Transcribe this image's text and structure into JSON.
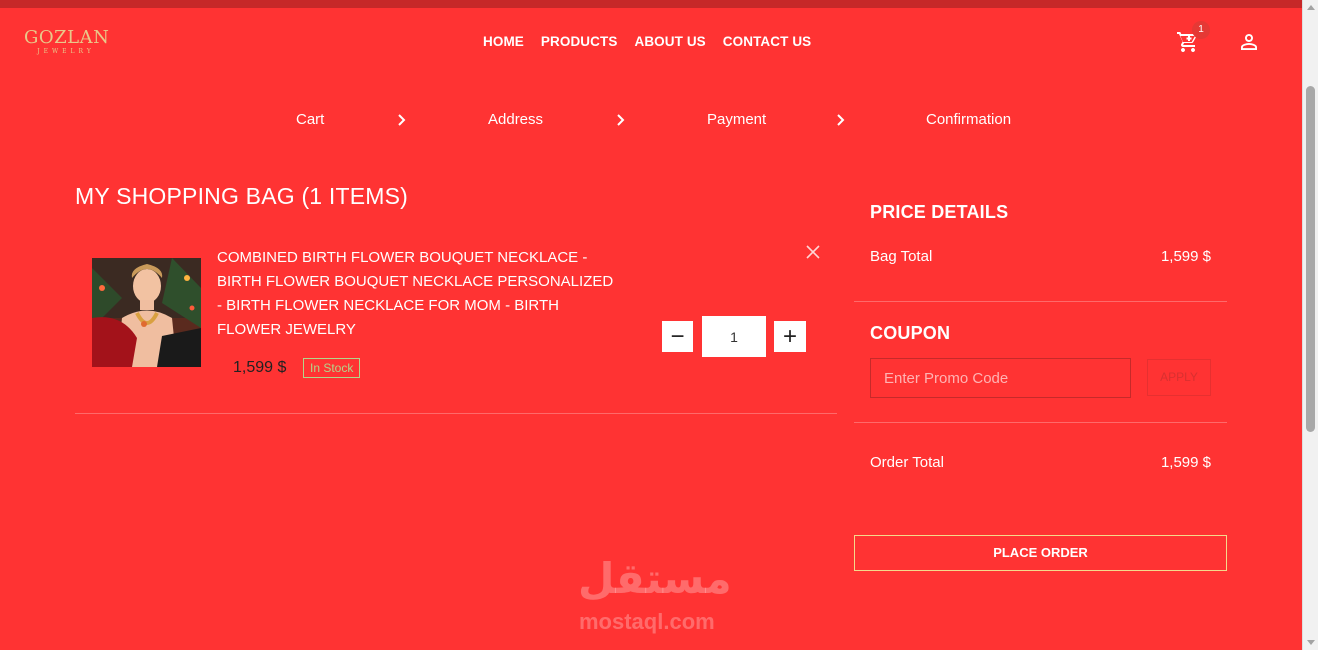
{
  "header": {
    "logo_main": "GOZLAN",
    "logo_sub": "JEWELRY",
    "nav": [
      "HOME",
      "PRODUCTS",
      "ABOUT US",
      "CONTACT US"
    ],
    "cart_count": "1",
    "cart_icon": "shopping-cart-icon",
    "user_icon": "user-icon"
  },
  "steps": [
    "Cart",
    "Address",
    "Payment",
    "Confirmation"
  ],
  "bag": {
    "title": "MY SHOPPING BAG (1 ITEMS)",
    "item": {
      "name": "COMBINED BIRTH FLOWER BOUQUET NECKLACE - BIRTH FLOWER BOUQUET NECKLACE PERSONALIZED - BIRTH FLOWER NECKLACE FOR MOM - BIRTH FLOWER JEWELRY",
      "price": "1,599 $",
      "stock": "In Stock",
      "quantity": "1",
      "minus": "−",
      "plus": "+"
    }
  },
  "price_details": {
    "title": "PRICE DETAILS",
    "bag_total_label": "Bag Total",
    "bag_total_value": "1,599 $"
  },
  "coupon": {
    "title": "COUPON",
    "placeholder": "Enter Promo Code",
    "apply_label": "APPLY"
  },
  "order": {
    "total_label": "Order Total",
    "total_value": "1,599 $",
    "place_order_label": "PLACE ORDER"
  },
  "watermark": {
    "arabic": "مستقل",
    "latin": "mostaql.com"
  },
  "colors": {
    "background": "#ff3333",
    "accent_gold": "#e9c88a",
    "stock_green": "#b2d68a",
    "badge": "#e53935"
  }
}
